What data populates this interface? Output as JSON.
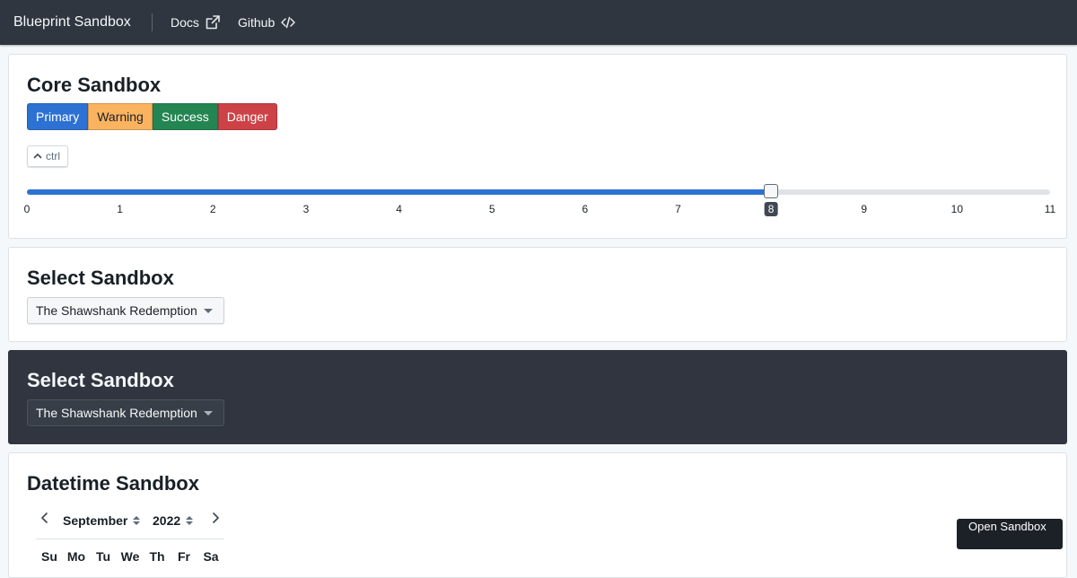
{
  "navbar": {
    "title": "Blueprint Sandbox",
    "links": [
      {
        "label": "Docs",
        "icon": "share-icon"
      },
      {
        "label": "Github",
        "icon": "code-icon"
      }
    ]
  },
  "core": {
    "title": "Core Sandbox",
    "buttons": [
      {
        "label": "Primary",
        "intent": "primary",
        "color": "#2d72d2"
      },
      {
        "label": "Warning",
        "intent": "warning",
        "color": "#fbb360"
      },
      {
        "label": "Success",
        "intent": "success",
        "color": "#238551"
      },
      {
        "label": "Danger",
        "intent": "danger",
        "color": "#cd4246"
      }
    ],
    "kbd": {
      "icon": "caret-up-icon",
      "label": "ctrl"
    },
    "slider": {
      "min": 0,
      "max": 11,
      "value": 8,
      "value_label": "8",
      "ticks": [
        "0",
        "1",
        "2",
        "3",
        "4",
        "5",
        "6",
        "7",
        "8",
        "9",
        "10",
        "11"
      ]
    }
  },
  "select_light": {
    "title": "Select Sandbox",
    "value": "The Shawshank Redemption"
  },
  "select_dark": {
    "title": "Select Sandbox",
    "value": "The Shawshank Redemption"
  },
  "datetime": {
    "title": "Datetime Sandbox",
    "month": "September",
    "year": "2022",
    "weekdays": [
      "Su",
      "Mo",
      "Tu",
      "We",
      "Th",
      "Fr",
      "Sa"
    ]
  },
  "tooltip": {
    "label": "Open Sandbox"
  },
  "colors": {
    "navbar": "#30363f",
    "dark_card": "#30353f",
    "accent": "#2d72d2"
  }
}
